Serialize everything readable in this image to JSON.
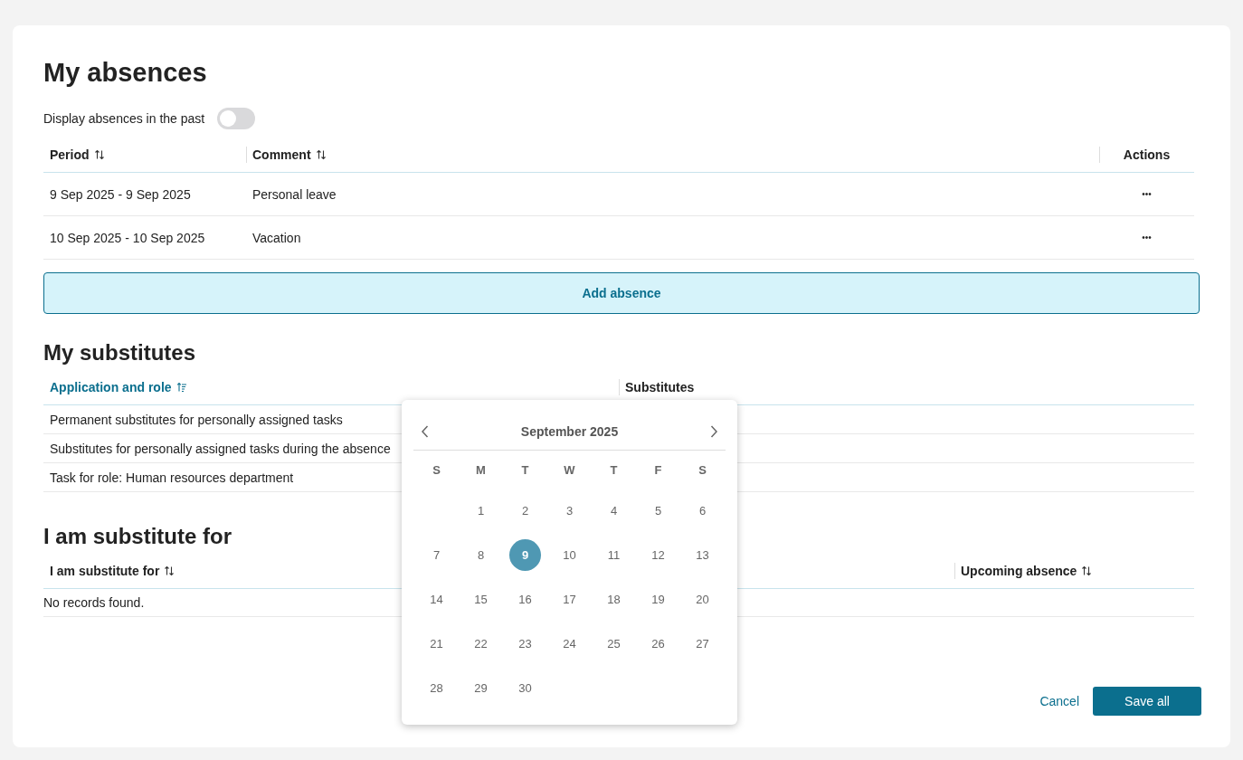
{
  "title": "My absences",
  "past_toggle": {
    "label": "Display absences in the past",
    "on": false
  },
  "absences": {
    "columns": [
      {
        "label": "Period",
        "sortable": true,
        "sorted": false
      },
      {
        "label": "Comment",
        "sortable": true,
        "sorted": false
      },
      {
        "label": "Actions"
      }
    ],
    "rows": [
      {
        "period": "9 Sep 2025 - 9 Sep 2025",
        "comment": "Personal leave",
        "action": "•••"
      },
      {
        "period": "10 Sep 2025 - 10 Sep 2025",
        "comment": "Vacation",
        "action": "•••"
      }
    ]
  },
  "add_button": "Add absence",
  "substitutes": {
    "title": "My substitutes",
    "columns": [
      {
        "label": "Application and role",
        "sortable": true,
        "sorted": true
      },
      {
        "label": "Substitutes"
      }
    ],
    "rows": [
      {
        "role": "Permanent substitutes for personally assigned tasks"
      },
      {
        "role": "Substitutes for personally assigned tasks during the absence"
      },
      {
        "role": "Task for role: Human resources department"
      }
    ]
  },
  "substitute_for": {
    "title": "I am substitute for",
    "columns": [
      {
        "label": "I am substitute for",
        "sortable": true,
        "sorted": false
      },
      {
        "label": "Upcoming absence",
        "sortable": true,
        "sorted": false
      }
    ],
    "empty": "No records found."
  },
  "buttons": {
    "cancel": "Cancel",
    "save": "Save all"
  },
  "calendar": {
    "month": "September 2025",
    "weekdays": [
      "S",
      "M",
      "T",
      "W",
      "T",
      "F",
      "S"
    ],
    "weeks": [
      {
        "days": [
          {
            "label": "1",
            "selected": false
          },
          {
            "label": "2",
            "selected": false
          },
          {
            "label": "3",
            "selected": false
          },
          {
            "label": "4",
            "selected": false
          },
          {
            "label": "5",
            "selected": false
          },
          {
            "label": "6",
            "selected": false
          }
        ]
      },
      {
        "days": [
          {
            "label": "7",
            "selected": false
          },
          {
            "label": "8",
            "selected": false
          },
          {
            "label": "9",
            "selected": true
          },
          {
            "label": "10",
            "selected": false
          },
          {
            "label": "11",
            "selected": false
          },
          {
            "label": "12",
            "selected": false
          },
          {
            "label": "13",
            "selected": false
          }
        ]
      },
      {
        "days": [
          {
            "label": "14",
            "selected": false
          },
          {
            "label": "15",
            "selected": false
          },
          {
            "label": "16",
            "selected": false
          },
          {
            "label": "17",
            "selected": false
          },
          {
            "label": "18",
            "selected": false
          },
          {
            "label": "19",
            "selected": false
          },
          {
            "label": "20",
            "selected": false
          }
        ]
      },
      {
        "days": [
          {
            "label": "21",
            "selected": false
          },
          {
            "label": "22",
            "selected": false
          },
          {
            "label": "23",
            "selected": false
          },
          {
            "label": "24",
            "selected": false
          },
          {
            "label": "25",
            "selected": false
          },
          {
            "label": "26",
            "selected": false
          },
          {
            "label": "27",
            "selected": false
          }
        ]
      },
      {
        "days": [
          {
            "label": "28",
            "selected": false
          },
          {
            "label": "29",
            "selected": false
          },
          {
            "label": "30",
            "selected": false
          }
        ]
      }
    ]
  }
}
